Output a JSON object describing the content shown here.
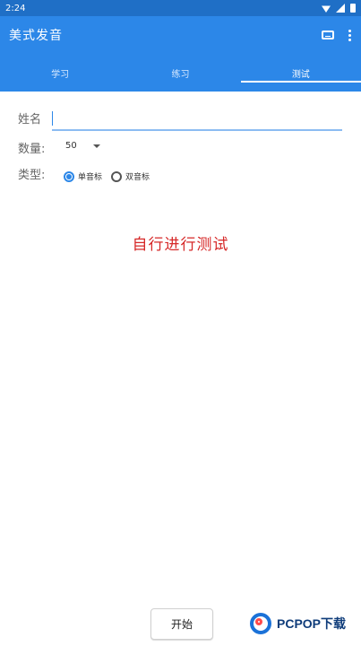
{
  "statusbar": {
    "time": "2:24",
    "icons": [
      "wifi-icon",
      "signal-icon",
      "battery-icon"
    ]
  },
  "appbar": {
    "title": "美式发音",
    "actions": [
      "keyboard-icon",
      "more-options-icon"
    ]
  },
  "tabs": [
    {
      "label": "学习",
      "active": false
    },
    {
      "label": "练习",
      "active": false
    },
    {
      "label": "测试",
      "active": true
    }
  ],
  "form": {
    "name_label": "姓名",
    "name_value": "",
    "quantity_label": "数量:",
    "quantity_value": "50",
    "type_label": "类型:",
    "type_options": [
      {
        "label": "单音标",
        "checked": true
      },
      {
        "label": "双音标",
        "checked": false
      }
    ]
  },
  "caption": "自行进行测试",
  "start_label": "开始",
  "watermark": {
    "text": "PCPOP下载"
  },
  "colors": {
    "primary": "#2c87e8",
    "status_bar": "#1f6fc6",
    "caption_red": "#d62828"
  }
}
